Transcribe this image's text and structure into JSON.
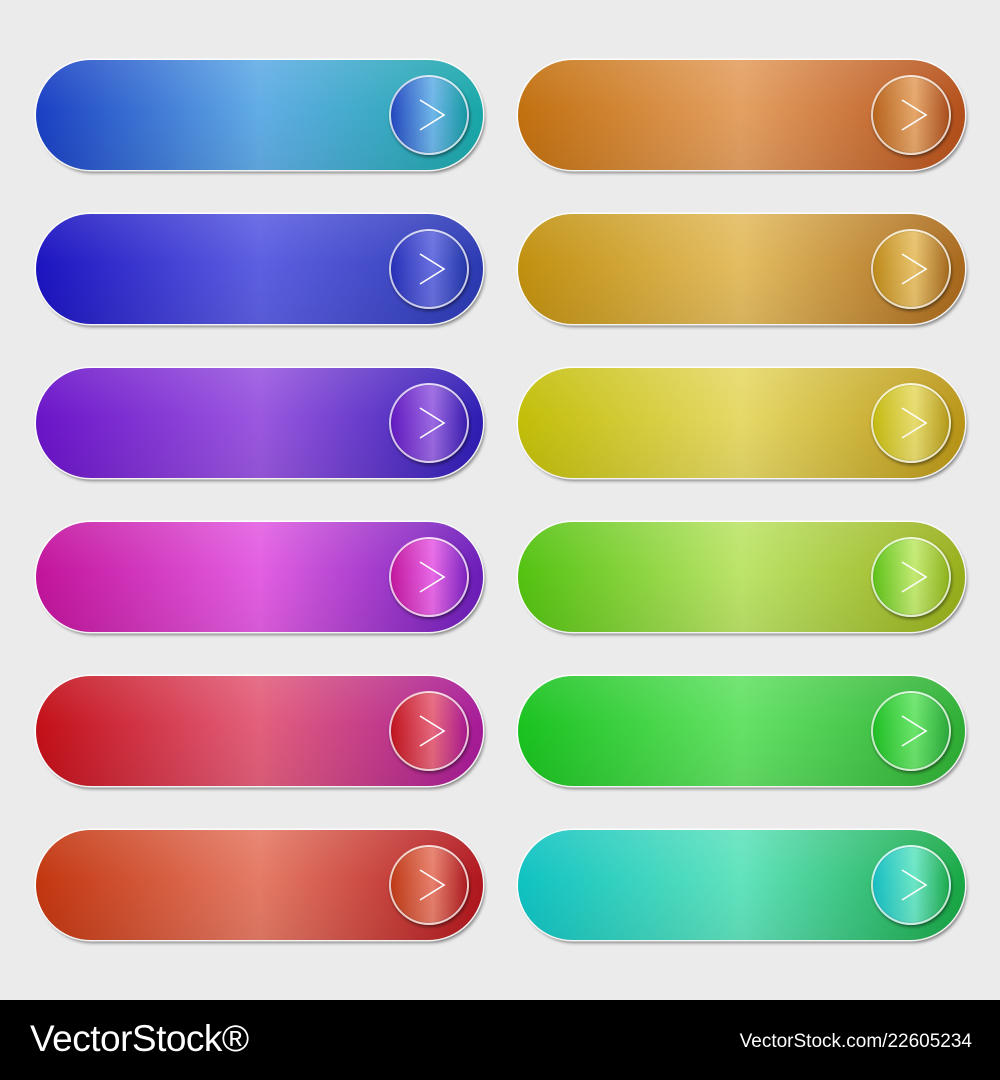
{
  "buttons": [
    {
      "colors": [
        "#1a3fc3",
        "#62ade6",
        "#19a8a8"
      ],
      "knob": [
        "#2448c0",
        "#6fb6e8",
        "#1699a3"
      ]
    },
    {
      "colors": [
        "#c2700f",
        "#e4a062",
        "#b44f1a"
      ],
      "knob": [
        "#b7631c",
        "#e5a76b",
        "#a94e1c"
      ]
    },
    {
      "colors": [
        "#1c13c0",
        "#5d60e2",
        "#2c3ab2"
      ],
      "knob": [
        "#2730b7",
        "#6870e0",
        "#2336a8"
      ]
    },
    {
      "colors": [
        "#c0900f",
        "#e4bd62",
        "#a8681c"
      ],
      "knob": [
        "#bd8a1a",
        "#e8c26c",
        "#a46a1f"
      ]
    },
    {
      "colors": [
        "#6a13c8",
        "#9b58e0",
        "#2d1db2"
      ],
      "knob": [
        "#6218c0",
        "#9b6ae2",
        "#3b1eb0"
      ]
    },
    {
      "colors": [
        "#c2be08",
        "#e6d968",
        "#b99516"
      ],
      "knob": [
        "#c4ba10",
        "#e8dc70",
        "#b49a1a"
      ]
    },
    {
      "colors": [
        "#c2139b",
        "#e35fe2",
        "#6a1cb8"
      ],
      "knob": [
        "#c3179f",
        "#e769e6",
        "#7d23c0"
      ]
    },
    {
      "colors": [
        "#52c210",
        "#bde46a",
        "#97ae1a"
      ],
      "knob": [
        "#5ec218",
        "#c4ea74",
        "#8fb21c"
      ]
    },
    {
      "colors": [
        "#c20f17",
        "#e3607c",
        "#a51a98"
      ],
      "knob": [
        "#c0141d",
        "#e6687e",
        "#a9198f"
      ]
    },
    {
      "colors": [
        "#19c21f",
        "#65e266",
        "#2eae34"
      ],
      "knob": [
        "#1fbf25",
        "#6ce56c",
        "#2aa93a"
      ]
    },
    {
      "colors": [
        "#c2360f",
        "#e57b66",
        "#b0161d"
      ],
      "knob": [
        "#bf3a16",
        "#e7806d",
        "#ad1c22"
      ]
    },
    {
      "colors": [
        "#0fc2c2",
        "#62e3bd",
        "#18a744"
      ],
      "knob": [
        "#16bec4",
        "#6de6c5",
        "#1eaa4d"
      ]
    }
  ],
  "footer": {
    "brand": "VectorStock®",
    "stock_id": "VectorStock.com/22605234"
  }
}
